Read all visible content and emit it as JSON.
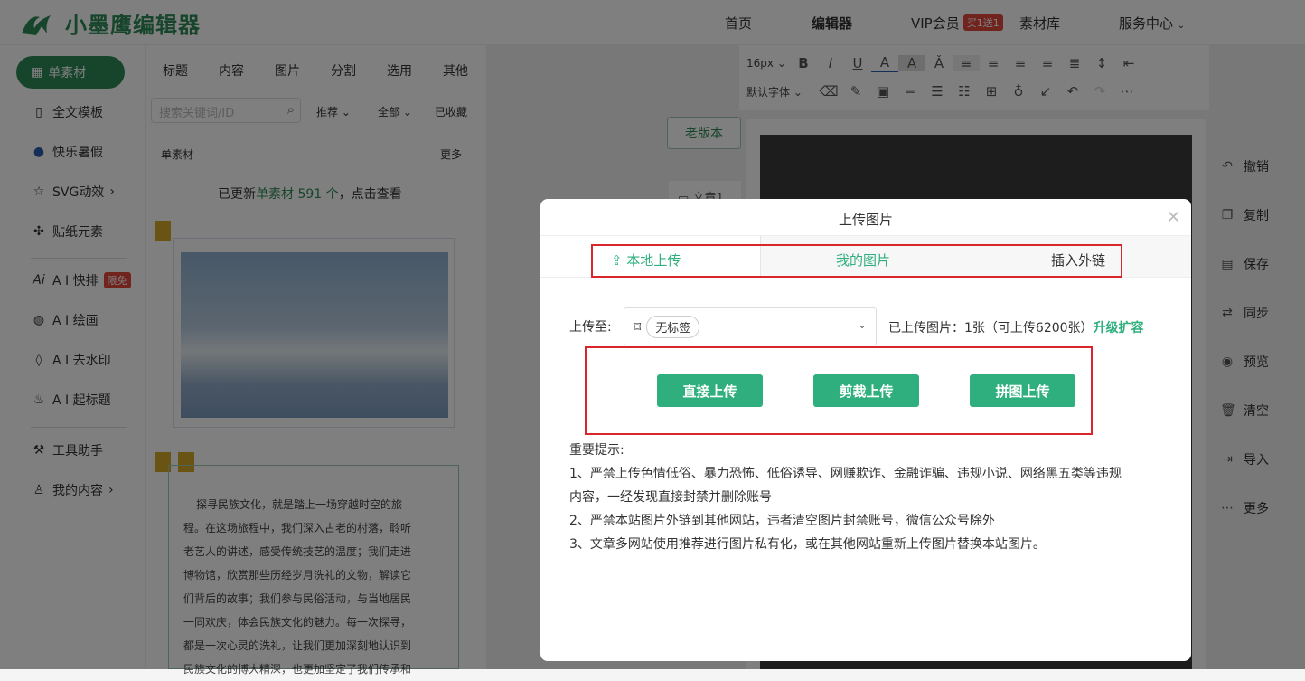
{
  "header": {
    "logo_text": "小墨鹰编辑器",
    "nav": [
      "首页",
      "编辑器",
      "VIP会员",
      "素材库",
      "服务中心"
    ],
    "vip_badge": "买1送1"
  },
  "sidebar": {
    "items": [
      {
        "label": "单素材",
        "icon": "grid-icon",
        "active": true
      },
      {
        "label": "全文模板",
        "icon": "template-icon"
      },
      {
        "label": "快乐暑假",
        "icon": "ball-icon"
      },
      {
        "label": "SVG动效",
        "icon": "star-icon"
      },
      {
        "label": "贴纸元素",
        "icon": "puzzle-icon"
      },
      {
        "label": "A I 快排",
        "icon": "ai-icon",
        "badge": "限免"
      },
      {
        "label": "A I 绘画",
        "icon": "palette-icon"
      },
      {
        "label": "A I 去水印",
        "icon": "drop-icon"
      },
      {
        "label": "A I 起标题",
        "icon": "fire-icon"
      },
      {
        "label": "工具助手",
        "icon": "tools-icon"
      },
      {
        "label": "我的内容",
        "icon": "user-icon"
      }
    ]
  },
  "panel": {
    "tabs": [
      "标题",
      "内容",
      "图片",
      "分割",
      "选用",
      "其他"
    ],
    "search_placeholder": "搜索关键词/ID",
    "filters": [
      "推荐",
      "全部",
      "已收藏"
    ],
    "section_title": "单素材",
    "more": "更多",
    "update_prefix": "已更新",
    "update_link": "单素材 591 个",
    "update_suffix": "，点击查看",
    "article_lines": [
      "探寻民族文化，就是踏上一场穿越时空的旅",
      "程。在这场旅程中，我们深入古老的村落，聆听",
      "老艺人的讲述，感受传统技艺的温度；我们走进",
      "博物馆，欣赏那些历经岁月洗礼的文物，解读它",
      "们背后的故事；我们参与民俗活动，与当地居民",
      "一同欢庆，体会民族文化的魅力。每一次探寻，",
      "都是一次心灵的洗礼，让我们更加深刻地认识到",
      "民族文化的博大精深，也更加坚定了我们传承和"
    ]
  },
  "editor": {
    "old_version": "老版本",
    "article_tab": "文章1",
    "font_size": "16px",
    "font_family": "默认字体"
  },
  "right_actions": [
    "撤销",
    "复制",
    "保存",
    "同步",
    "预览",
    "清空",
    "导入",
    "更多"
  ],
  "modal": {
    "title": "上传图片",
    "tabs": [
      "本地上传",
      "我的图片",
      "插入外链"
    ],
    "upload_to_label": "上传至:",
    "tag": "无标签",
    "uploaded_info": "已上传图片：1张（可上传6200张）",
    "upgrade": "升级扩容",
    "buttons": [
      "直接上传",
      "剪裁上传",
      "拼图上传"
    ],
    "notice_title": "重要提示:",
    "notices": [
      "1、严禁上传色情低俗、暴力恐怖、低俗诱导、网赚欺诈、金融诈骗、违规小说、网络黑五类等违规",
      "内容，一经发现直接封禁并删除账号",
      "2、严禁本站图片外链到其他网站，违者清空图片封禁账号，微信公众号除外",
      "3、文章多网站使用推荐进行图片私有化，或在其他网站重新上传图片替换本站图片。"
    ]
  },
  "colors": {
    "brand": "#2e8b57",
    "button": "#2eaf7d",
    "highlight": "#d9262c"
  }
}
